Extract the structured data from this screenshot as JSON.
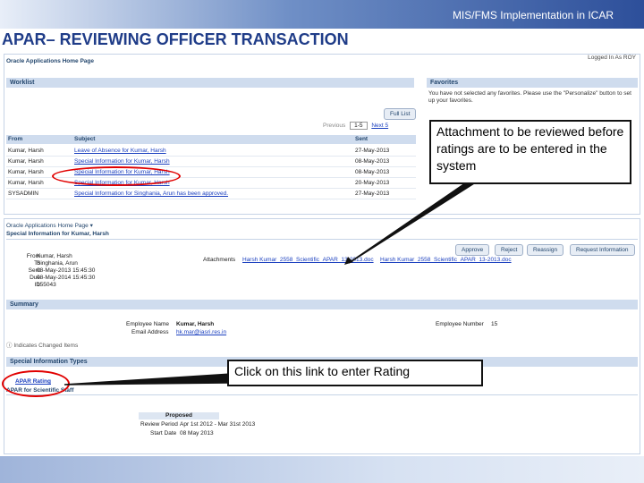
{
  "header": {
    "title": "MIS/FMS Implementation in ICAR"
  },
  "slide_title": "APAR– REVIEWING OFFICER TRANSACTION",
  "home": {
    "breadcrumb": "Oracle Applications Home Page",
    "logged_in": "Logged In As ROY",
    "worklist_title": "Worklist",
    "full_list": "Full List",
    "pagination": {
      "previous": "Previous",
      "range": "1-5",
      "next": "Next 5"
    },
    "columns": [
      "From",
      "Subject",
      "Sent"
    ],
    "rows": [
      {
        "from": "Kumar, Harsh",
        "subject": "Leave of Absence for Kumar, Harsh",
        "sent": "27-May-2013"
      },
      {
        "from": "Kumar, Harsh",
        "subject": "Special Information for Kumar, Harsh",
        "sent": "08-May-2013"
      },
      {
        "from": "Kumar, Harsh",
        "subject": "Special Information for Kumar, Harsh",
        "sent": "08-May-2013"
      },
      {
        "from": "Kumar, Harsh",
        "subject": "Special Information for Kumar, Harsh",
        "sent": "20-May-2013"
      },
      {
        "from": "SYSADMIN",
        "subject": "Special Information for Singhania, Arun has been approved.",
        "sent": "27-May-2013"
      }
    ],
    "favorites_title": "Favorites",
    "favorites_text": "You have not selected any favorites. Please use the \"Personalize\" button to set up your favorites."
  },
  "detail": {
    "breadcrumb": "Oracle Applications Home Page",
    "title": "Special Information for Kumar, Harsh",
    "fields": [
      {
        "label": "From",
        "value": "Kumar, Harsh"
      },
      {
        "label": "To",
        "value": "Singhania, Arun"
      },
      {
        "label": "Sent",
        "value": "08-May-2013 15:45:30"
      },
      {
        "label": "Due",
        "value": "08-May-2014 15:45:30"
      },
      {
        "label": "ID",
        "value": "155043"
      }
    ],
    "attachments_label": "Attachments",
    "attachments": [
      "Harsh Kumar_2558_Scientific_APAR_13-2013.doc",
      "Harsh Kumar_2558_Scientific_APAR_13-2013.doc"
    ],
    "buttons": [
      "Approve",
      "Reject",
      "Reassign",
      "Request Information"
    ],
    "summary_title": "Summary",
    "employee_name_label": "Employee Name",
    "employee_name": "Kumar, Harsh",
    "email_label": "Email Address",
    "email": "hk.mar@iasri.res.in",
    "employee_number_label": "Employee Number",
    "employee_number": "15",
    "changed_note": "Indicates Changed Items",
    "sit_title": "Special Information Types",
    "apar_link": "APAR Rating",
    "apar_for": "APAR for Scientific Staff",
    "proposed": "Proposed",
    "review_period_label": "Review Period",
    "review_period": "Apr 1st 2012 - Mar 31st 2013",
    "start_date_label": "Start Date",
    "start_date": "08 May 2013"
  },
  "callouts": {
    "attachment": "Attachment to be reviewed before ratings are to be entered in the system",
    "rating": "Click on this link to enter Rating"
  }
}
